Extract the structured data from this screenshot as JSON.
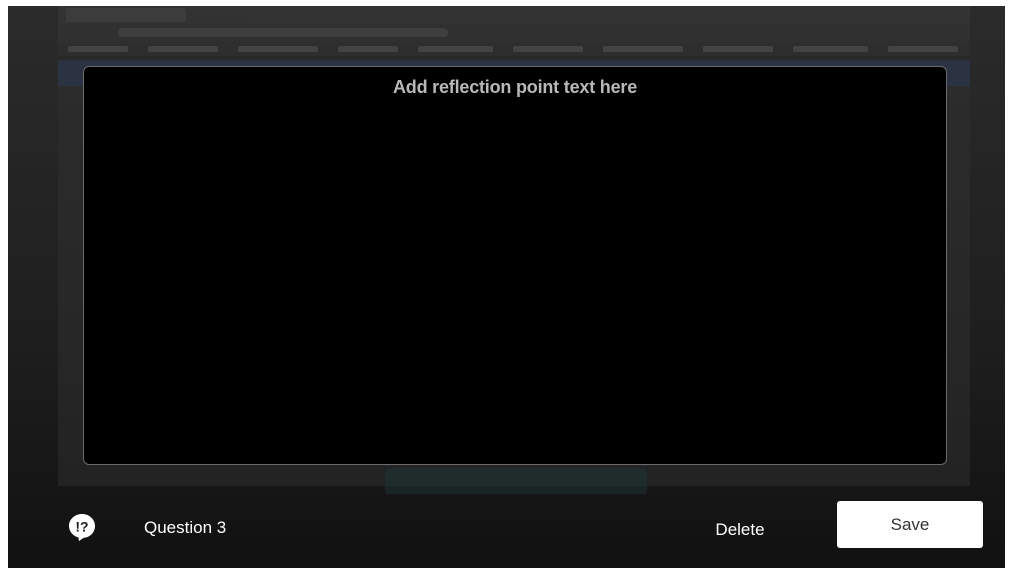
{
  "preview": {
    "text": "Add reflection point text here"
  },
  "footer": {
    "icon": "question-exclamation-bubble-icon",
    "question_label": "Question 3",
    "delete_label": "Delete",
    "save_label": "Save"
  },
  "colors": {
    "overlay": "#1e1e1e",
    "preview_bg": "#000000",
    "preview_text": "#b8b8b8",
    "save_bg": "#ffffff"
  }
}
